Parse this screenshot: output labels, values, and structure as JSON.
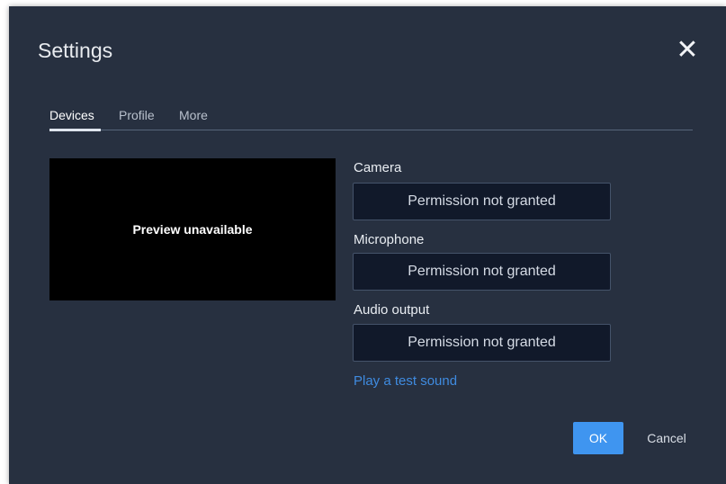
{
  "dialog": {
    "title": "Settings",
    "close_icon": "close-icon",
    "close_glyph": "✕"
  },
  "tabs": [
    {
      "label": "Devices",
      "active": true
    },
    {
      "label": "Profile",
      "active": false
    },
    {
      "label": "More",
      "active": false
    }
  ],
  "preview": {
    "text": "Preview unavailable"
  },
  "devices": {
    "camera": {
      "label": "Camera",
      "value": "Permission not granted"
    },
    "microphone": {
      "label": "Microphone",
      "value": "Permission not granted"
    },
    "audio_output": {
      "label": "Audio output",
      "value": "Permission not granted"
    }
  },
  "test_sound_link": "Play a test sound",
  "buttons": {
    "ok": "OK",
    "cancel": "Cancel"
  },
  "colors": {
    "dialog_bg": "#273040",
    "select_bg": "#11192a",
    "accent": "#3f95f0",
    "link": "#3f8be0"
  }
}
